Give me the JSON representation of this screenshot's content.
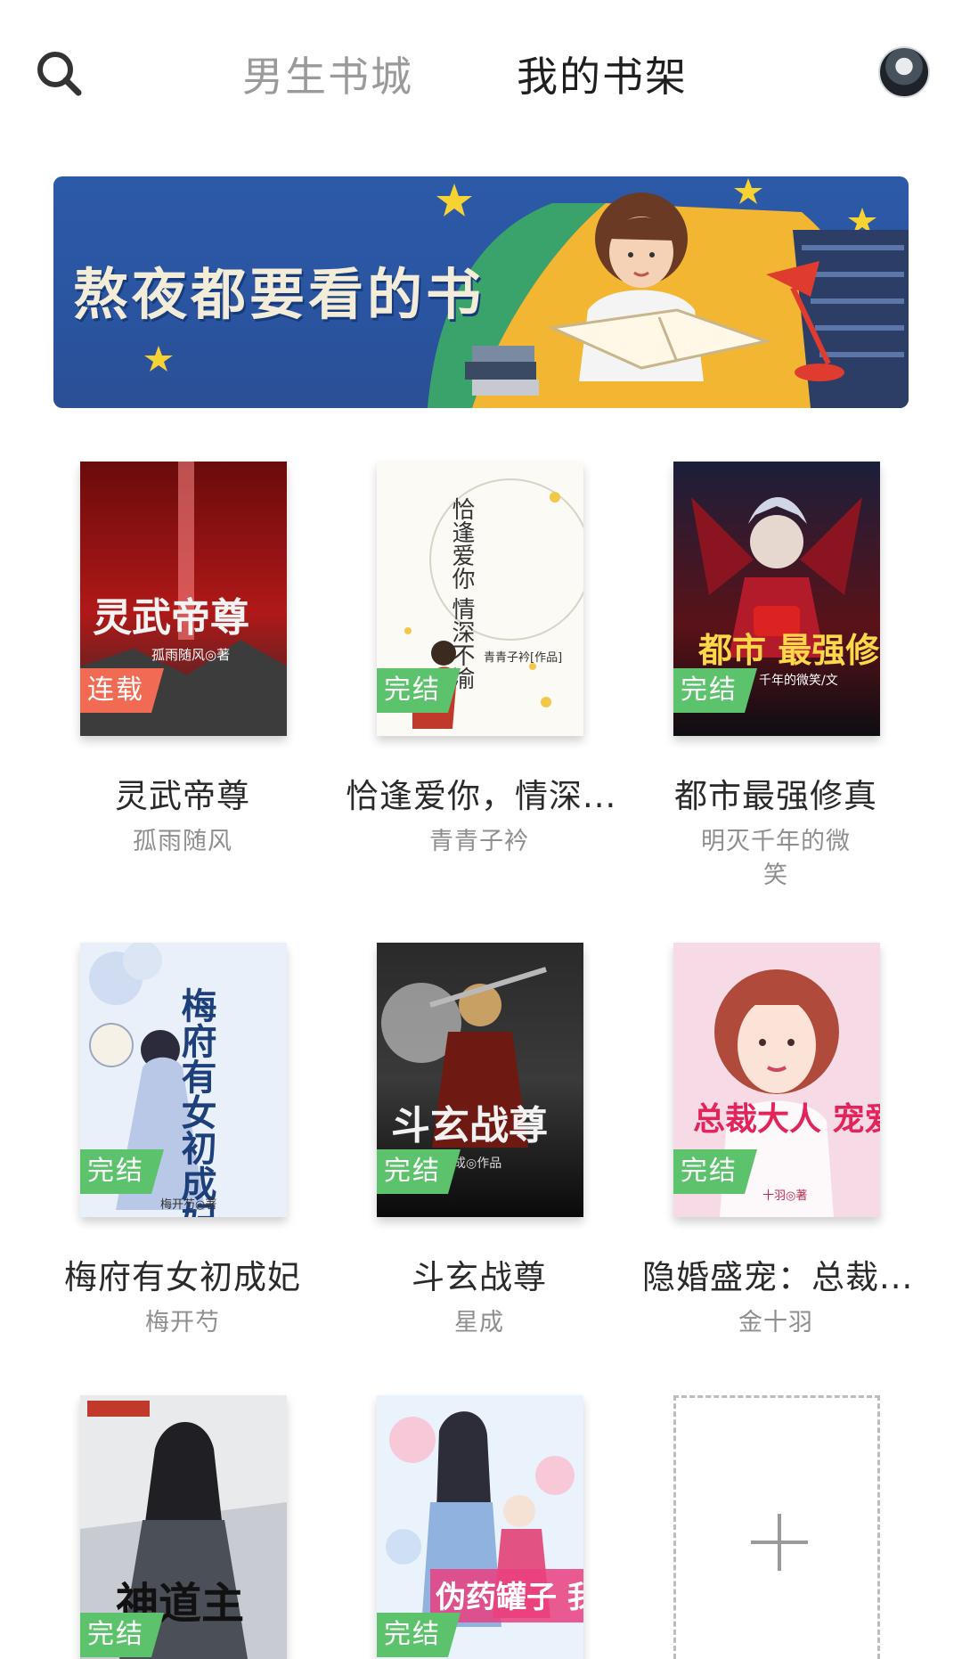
{
  "header": {
    "search_icon": "search-icon",
    "tabs": [
      {
        "label": "男生书城",
        "active": false
      },
      {
        "label": "我的书架",
        "active": true
      }
    ],
    "avatar_icon": "avatar"
  },
  "banner": {
    "title": "熬夜都要看的书"
  },
  "books": [
    {
      "title": "灵武帝尊",
      "author": "孤雨随风",
      "status": "连载",
      "cover_text": "灵武帝尊",
      "cover_sub": "孤雨随风◎著"
    },
    {
      "title": "恰逢爱你，情深...",
      "author": "青青子衿",
      "status": "完结",
      "cover_text": "恰逢爱你 情深不渝",
      "cover_sub": "青青子衿[作品]"
    },
    {
      "title": "都市最强修真",
      "author": "明灭千年的微笑",
      "status": "完结",
      "cover_text": "都市 最强修真",
      "cover_sub": "千年的微笑/文"
    },
    {
      "title": "梅府有女初成妃",
      "author": "梅开芍",
      "status": "完结",
      "cover_text": "梅府有女初成妃",
      "cover_sub": "梅开芍◎著"
    },
    {
      "title": "斗玄战尊",
      "author": "星成",
      "status": "完结",
      "cover_text": "斗玄战尊",
      "cover_sub": "星成◎作品"
    },
    {
      "title": "隐婚盛宠：总裁...",
      "author": "金十羽",
      "status": "完结",
      "cover_text": "总裁大人 宠爱",
      "cover_sub": "十羽◎著"
    },
    {
      "title": "",
      "author": "",
      "status": "完结",
      "cover_text": "神道主"
    },
    {
      "title": "",
      "author": "",
      "status": "完结",
      "cover_text": "伪药罐子 我的夫君"
    }
  ],
  "add_slot": {
    "icon": "plus-icon"
  },
  "colors": {
    "badge_done": "#5cc26c",
    "badge_ongoing": "#f06a54",
    "tab_active": "#1f1f1f",
    "tab_inactive": "#9a9a9a"
  }
}
